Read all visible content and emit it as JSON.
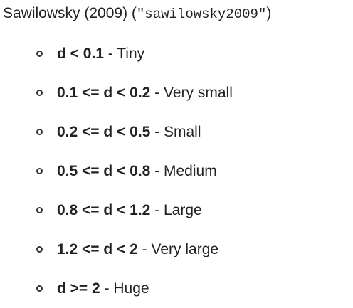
{
  "heading": {
    "text": "Sawilowsky (2009) (",
    "code": "\"sawilowsky2009\"",
    "close": ")"
  },
  "items": [
    {
      "condition": "d < 0.1",
      "label": " - Tiny"
    },
    {
      "condition": "0.1 <= d < 0.2",
      "label": " - Very small"
    },
    {
      "condition": "0.2 <= d < 0.5",
      "label": " - Small"
    },
    {
      "condition": "0.5 <= d < 0.8",
      "label": " - Medium"
    },
    {
      "condition": "0.8 <= d < 1.2",
      "label": " - Large"
    },
    {
      "condition": "1.2 <= d < 2",
      "label": " - Very large"
    },
    {
      "condition": "d >= 2",
      "label": " - Huge"
    }
  ]
}
